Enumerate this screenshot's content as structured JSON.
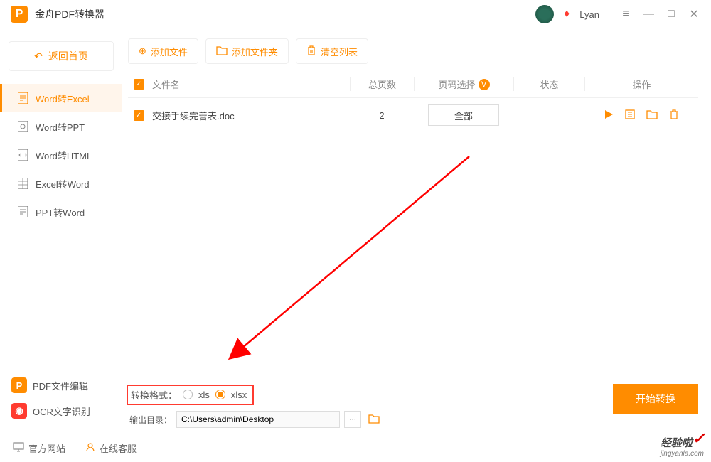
{
  "app": {
    "title": "金舟PDF转换器",
    "user": "Lyan"
  },
  "sidebar": {
    "back": "返回首页",
    "items": [
      {
        "label": "Word转Excel"
      },
      {
        "label": "Word转PPT"
      },
      {
        "label": "Word转HTML"
      },
      {
        "label": "Excel转Word"
      },
      {
        "label": "PPT转Word"
      }
    ]
  },
  "bottom_left": {
    "pdf_edit": "PDF文件编辑",
    "ocr": "OCR文字识别"
  },
  "toolbar": {
    "add_file": "添加文件",
    "add_folder": "添加文件夹",
    "clear": "清空列表"
  },
  "table": {
    "headers": {
      "name": "文件名",
      "pages": "总页数",
      "select": "页码选择",
      "status": "状态",
      "ops": "操作"
    },
    "rows": [
      {
        "name": "交接手续完善表.doc",
        "pages": "2",
        "select": "全部"
      }
    ]
  },
  "format": {
    "label": "转换格式：",
    "opt1": "xls",
    "opt2": "xlsx"
  },
  "output": {
    "label": "输出目录：",
    "path": "C:\\Users\\admin\\Desktop"
  },
  "convert": "开始转换",
  "footer": {
    "website": "官方网站",
    "support": "在线客服"
  },
  "watermark": {
    "brand": "经验啦",
    "domain": "jingyanla.com"
  }
}
